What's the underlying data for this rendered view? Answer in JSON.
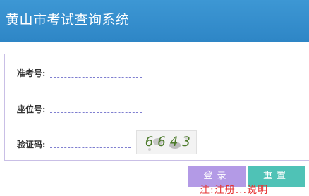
{
  "header": {
    "title": "黄山市考试查询系统"
  },
  "form": {
    "exam_number_label": "准考号:",
    "seat_number_label": "座位号:",
    "captcha_label": "验证码:",
    "captcha_value": "6643"
  },
  "buttons": {
    "login_label": "登录",
    "reset_label": "重置"
  },
  "footer": {
    "partial_text": "注:注册...说明"
  },
  "colors": {
    "header_bg": "#2e86c6",
    "login_bg": "#b39ae6",
    "reset_bg": "#4fc2b6",
    "field_underline": "#7f7fd0",
    "captcha_text": "#4c7a2a"
  }
}
